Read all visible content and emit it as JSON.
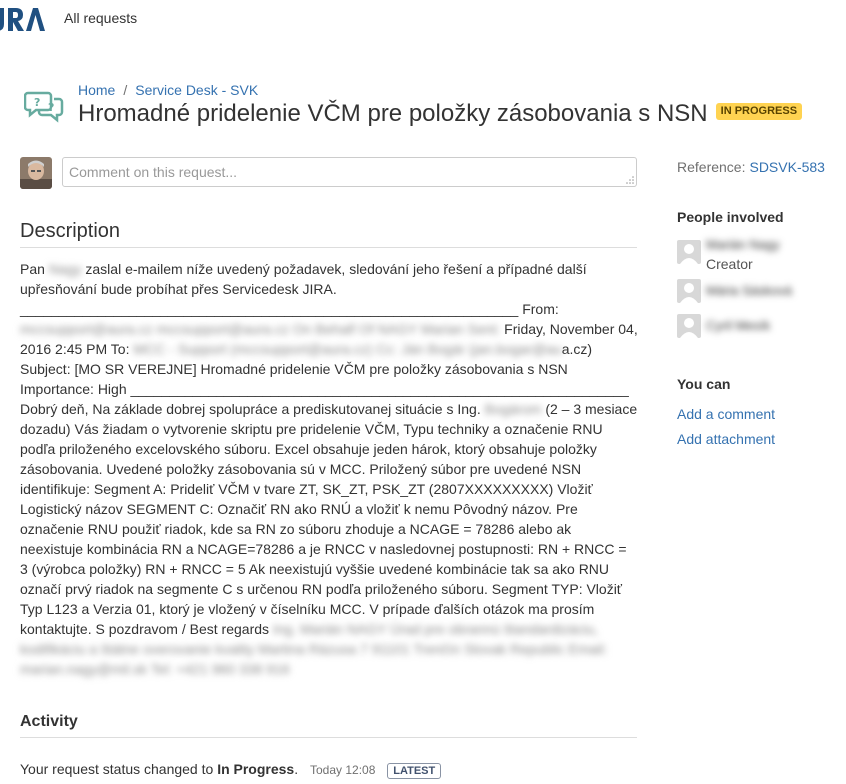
{
  "header": {
    "all_requests": "All requests"
  },
  "breadcrumb": {
    "home": "Home",
    "service_desk": "Service Desk - SVK"
  },
  "title": "Hromadné pridelenie VČM pre položky zásobovania s NSN",
  "status": {
    "label": "IN PROGRESS",
    "color": "#ffd351"
  },
  "comment": {
    "placeholder": "Comment on this request..."
  },
  "description": {
    "heading": "Description",
    "p1_a": "Pan",
    "p1_b": "Nagy",
    "p1_c": "zaslal e-mailem níže uvedený požadavek, sledování jeho řešení a případné další upřesňování bude probíhat přes Servicedesk JIRA.",
    "line1": "________________________________________________________________ From:",
    "from_blur": "mccsupport@aura.cz mccsupport@aura.cz On Behalf Of NAGY Marian Sent:",
    "date": "Friday, November 04, 2016 2:45 PM To:",
    "to_blur": "MCC - Support (mccsupport@aura.cz) Cc: Ján Bogár (jan.bogar@au",
    "to_end": "a.cz)",
    "subject": "Subject: [MO SR VEREJNE] Hromadné pridelenie VČM pre položky zásobovania s NSN",
    "importance": "Importance: High",
    "line2": "________________________________________________________________ Dobrý deň, Na základe dobrej spolupráce a prediskutovanej situácie s Ing.",
    "name_blur": "Bogárom",
    "body": "(2 – 3 mesiace dozadu) Vás žiadam o vytvorenie skriptu pre pridelenie VČM, Typu techniky a označenie RNU podľa priloženého excelovského súboru. Excel obsahuje jeden hárok, ktorý obsahuje položky zásobovania. Uvedené položky zásobovania sú v MCC. Priložený súbor pre uvedené NSN identifikuje: Segment A: Prideliť VČM v tvare ZT, SK_ZT, PSK_ZT (2807XXXXXXXXX) Vložiť Logistický názov SEGMENT C: Označiť RN ako RNÚ a vložiť k nemu Pôvodný názov. Pre označenie RNU použiť riadok, kde sa RN zo súboru zhoduje a NCAGE = 78286 alebo ak neexistuje kombinácia RN a NCAGE=78286 a je RNCC v nasledovnej postupnosti: RN + RNCC = 3 (výrobca položky) RN + RNCC = 5 Ak neexistujú vyššie uvedené kombinácie tak sa ako RNU označí prvý riadok na segmente C s určenou RN podľa priloženého súboru. Segment TYP: Vložiť Typ L123 a Verzia 01, ktorý je vložený v číselníku MCC. V prípade ďalších otázok ma prosím kontaktujte. S pozdravom / Best regards",
    "sig_blur": "Ing. Marián NAGY Úrad pre obrannú štandardizáciu, kodifikáciu a štátne overovanie kvality Martina Rázusa 7 91101 Trenčín Slovak Republic Email: marian.nagy@mil.sk Tel: +421 960 338 916"
  },
  "activity": {
    "heading": "Activity",
    "text": "Your request status changed to",
    "status": "In Progress",
    "period": ".",
    "time": "Today 12:08",
    "badge": "LATEST"
  },
  "sidebar": {
    "reference_label": "Reference:",
    "reference_value": "SDSVK-583",
    "people_heading": "People involved",
    "people": [
      {
        "name": "Marián Nagy",
        "role": "Creator"
      },
      {
        "name": "Mária Sásková",
        "role": ""
      },
      {
        "name": "Cyril Mesík",
        "role": ""
      }
    ],
    "you_can_heading": "You can",
    "actions": [
      "Add a comment",
      "Add attachment"
    ]
  },
  "colors": {
    "link": "#3572b0",
    "logo": "#205081",
    "servicedesk_icon": "#67ab9f"
  },
  "icons": {
    "logo": "jira-logo",
    "service_desk": "speech-bubbles-icon"
  }
}
